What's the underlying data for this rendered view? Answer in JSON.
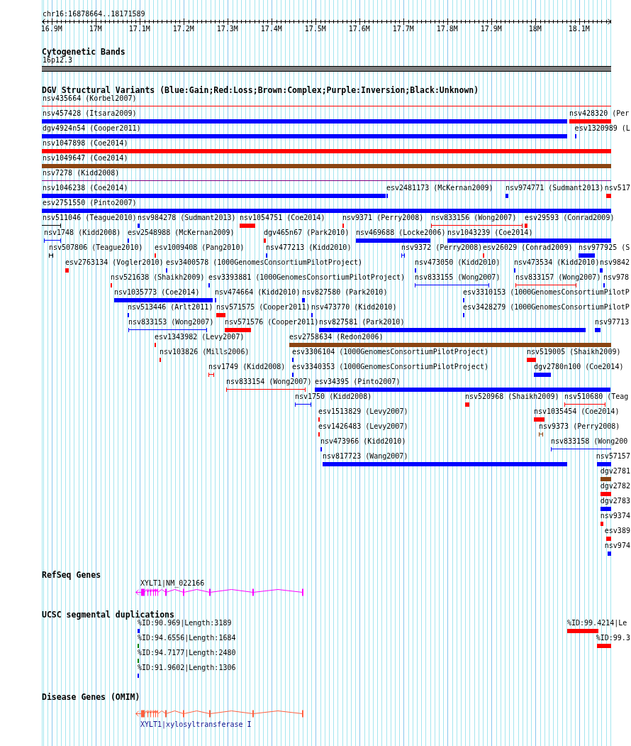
{
  "ruler": {
    "location": "chr16:16878664..18171589",
    "ticks": [
      "16.9M",
      "17M",
      "17.1M",
      "17.2M",
      "17.3M",
      "17.4M",
      "17.5M",
      "17.6M",
      "17.7M",
      "17.8M",
      "17.9M",
      "18M",
      "18.1M"
    ]
  },
  "tracks": [
    {
      "kind": "cytoband",
      "title": "Cytogenetic Bands",
      "band": {
        "label": "16p12.3"
      }
    },
    {
      "kind": "features",
      "title": "DGV Structural Variants (Blue:Gain;Red:Loss;Brown:Complex;Purple:Inversion;Black:Unknown)",
      "lanes": [
        {
          "features": [
            {
              "label": "nsv435664 (Korbel2007)",
              "kind": "span",
              "color": "#ff0000"
            }
          ]
        },
        {
          "features": [
            {
              "label": "nsv457428 (Itsara2009)",
              "kind": "bar",
              "color": "#0000ff"
            },
            {
              "label": "nsv428320 (Per",
              "kind": "bar",
              "color": "#ff0000"
            }
          ]
        },
        {
          "features": [
            {
              "label": "dgv4924n54 (Cooper2011)",
              "kind": "bar",
              "color": "#0000ff"
            },
            {
              "label": "esv1320989 (L",
              "kind": "bar",
              "color": "#0000ff"
            }
          ]
        },
        {
          "features": [
            {
              "label": "nsv1047898 (Coe2014)",
              "kind": "bar",
              "color": "#ff0000"
            }
          ]
        },
        {
          "features": [
            {
              "label": "nsv1049647 (Coe2014)",
              "kind": "bar",
              "color": "#8b4513"
            }
          ]
        },
        {
          "features": [
            {
              "label": "nsv7278 (Kidd2008)",
              "kind": "span",
              "color": "#800080"
            }
          ]
        },
        {
          "features": [
            {
              "label": "nsv1046238 (Coe2014)",
              "kind": "bar",
              "color": "#0000ff"
            },
            {
              "label": "esv2481173 (McKernan2009)",
              "kind": "bar",
              "color": "#0000ff"
            },
            {
              "label": "nsv974771 (Sudmant2013)",
              "kind": "bar",
              "color": "#0000ff"
            },
            {
              "label": "nsv517",
              "kind": "bar",
              "color": "#ff0000"
            }
          ]
        },
        {
          "features": [
            {
              "label": "esv2751550 (Pinto2007)",
              "kind": "bar",
              "color": "#0000ff"
            }
          ]
        },
        {
          "features": [
            {
              "label": "nsv511046 (Teague2010)",
              "kind": "span",
              "color": "#000000"
            },
            {
              "label": "nsv984278 (Sudmant2013)",
              "kind": "bar",
              "color": "#0000ff"
            },
            {
              "label": "nsv1054751 (Coe2014)",
              "kind": "bar",
              "color": "#ff0000"
            },
            {
              "label": "nsv9371 (Perry2008)",
              "kind": "bar",
              "color": "#ff0000"
            },
            {
              "label": "nsv833156 (Wong2007)",
              "kind": "span",
              "color": "#ff0000"
            },
            {
              "label": "esv29593 (Conrad2009)",
              "kind": "bar",
              "color": "#ff0000"
            }
          ]
        },
        {
          "features": [
            {
              "label": "nsv1748 (Kidd2008)",
              "kind": "span",
              "color": "#0000ff"
            },
            {
              "label": "esv2548988 (McKernan2009)",
              "kind": "bar",
              "color": "#0000ff"
            },
            {
              "label": "dgv465n67 (Park2010)",
              "kind": "bar",
              "color": "#ff0000"
            },
            {
              "label": "nsv469688 (Locke2006)",
              "kind": "bar",
              "color": "#0000ff"
            },
            {
              "label": "nsv1043239 (Coe2014)",
              "kind": "bar",
              "color": "#0000ff"
            }
          ]
        },
        {
          "features": [
            {
              "label": "nsv507806 (Teague2010)",
              "kind": "span",
              "color": "#000000"
            },
            {
              "label": "esv1009408 (Pang2010)",
              "kind": "bar",
              "color": "#ff0000"
            },
            {
              "label": "nsv477213 (Kidd2010)",
              "kind": "bar",
              "color": "#0000ff"
            },
            {
              "label": "nsv9372 (Perry2008)",
              "kind": "span",
              "color": "#0000ff"
            },
            {
              "label": "esv26029 (Conrad2009)",
              "kind": "bar",
              "color": "#ff0000"
            },
            {
              "label": "nsv977925 (S",
              "kind": "bar",
              "color": "#0000ff"
            }
          ]
        },
        {
          "features": [
            {
              "label": "esv2763134 (Vogler2010)",
              "kind": "bar",
              "color": "#ff0000"
            },
            {
              "label": "esv3400578 (1000GenomesConsortiumPilotProject)",
              "kind": "bar",
              "color": "#0000ff"
            },
            {
              "label": "nsv473050 (Kidd2010)",
              "kind": "bar",
              "color": "#0000ff"
            },
            {
              "label": "nsv473534 (Kidd2010)",
              "kind": "bar",
              "color": "#0000ff"
            },
            {
              "label": "nsv9842",
              "kind": "bar",
              "color": "#0000ff"
            }
          ]
        },
        {
          "features": [
            {
              "label": "nsv521638 (Shaikh2009)",
              "kind": "bar",
              "color": "#ff0000"
            },
            {
              "label": "esv3393881 (1000GenomesConsortiumPilotProject)",
              "kind": "bar",
              "color": "#0000ff"
            },
            {
              "label": "nsv833155 (Wong2007)",
              "kind": "span",
              "color": "#0000ff"
            },
            {
              "label": "nsv833157 (Wong2007)",
              "kind": "span",
              "color": "#ff0000"
            },
            {
              "label": "nsv978",
              "kind": "bar",
              "color": "#0000ff"
            }
          ]
        },
        {
          "features": [
            {
              "label": "nsv1035773 (Coe2014)",
              "kind": "bar",
              "color": "#0000ff"
            },
            {
              "label": "nsv474664 (Kidd2010)",
              "kind": "bar",
              "color": "#0000ff"
            },
            {
              "label": "nsv827580 (Park2010)",
              "kind": "bar",
              "color": "#0000ff"
            },
            {
              "label": "esv3310153 (1000GenomesConsortiumPilotP",
              "kind": "bar",
              "color": "#0000ff"
            }
          ]
        },
        {
          "features": [
            {
              "label": "nsv513446 (Arlt2011)",
              "kind": "bar",
              "color": "#0000ff"
            },
            {
              "label": "nsv571575 (Cooper2011)",
              "kind": "bar",
              "color": "#ff0000"
            },
            {
              "label": "nsv473770 (Kidd2010)",
              "kind": "bar",
              "color": "#0000ff"
            },
            {
              "label": "esv3428279 (1000GenomesConsortiumPilotP",
              "kind": "bar",
              "color": "#0000ff"
            }
          ]
        },
        {
          "features": [
            {
              "label": "nsv833153 (Wong2007)",
              "kind": "span",
              "color": "#0000ff"
            },
            {
              "label": "nsv571576 (Cooper2011)",
              "kind": "bar",
              "color": "#ff0000"
            },
            {
              "label": "nsv827581 (Park2010)",
              "kind": "bar",
              "color": "#0000ff"
            },
            {
              "label": "nsv97713",
              "kind": "bar",
              "color": "#0000ff"
            }
          ]
        },
        {
          "features": [
            {
              "label": "esv1343982 (Levy2007)",
              "kind": "bar",
              "color": "#ff0000"
            },
            {
              "label": "esv2758634 (Redon2006)",
              "kind": "bar",
              "color": "#8b4513"
            }
          ]
        },
        {
          "features": [
            {
              "label": "nsv103826 (Mills2006)",
              "kind": "bar",
              "color": "#ff0000"
            },
            {
              "label": "esv3306104 (1000GenomesConsortiumPilotProject)",
              "kind": "bar",
              "color": "#0000ff"
            },
            {
              "label": "nsv519005 (Shaikh2009)",
              "kind": "bar",
              "color": "#ff0000"
            }
          ]
        },
        {
          "features": [
            {
              "label": "nsv1749 (Kidd2008)",
              "kind": "span",
              "color": "#ff0000"
            },
            {
              "label": "esv3340353 (1000GenomesConsortiumPilotProject)",
              "kind": "bar",
              "color": "#0000ff"
            },
            {
              "label": "dgv2780n100 (Coe2014)",
              "kind": "bar",
              "color": "#0000ff"
            }
          ]
        },
        {
          "features": [
            {
              "label": "nsv833154 (Wong2007)",
              "kind": "span",
              "color": "#ff0000"
            },
            {
              "label": "esv34395 (Pinto2007)",
              "kind": "bar",
              "color": "#0000ff"
            }
          ]
        },
        {
          "features": [
            {
              "label": "nsv1750 (Kidd2008)",
              "kind": "span",
              "color": "#0000ff"
            },
            {
              "label": "nsv520968 (Shaikh2009)",
              "kind": "bar",
              "color": "#ff0000"
            },
            {
              "label": "nsv510680 (Teag",
              "kind": "span",
              "color": "#ff0000"
            }
          ]
        },
        {
          "features": [
            {
              "label": "esv1513829 (Levy2007)",
              "kind": "bar",
              "color": "#ff0000"
            },
            {
              "label": "nsv1035454 (Coe2014)",
              "kind": "bar",
              "color": "#ff0000"
            }
          ]
        },
        {
          "features": [
            {
              "label": "esv1426483 (Levy2007)",
              "kind": "bar",
              "color": "#ff0000"
            },
            {
              "label": "nsv9373 (Perry2008)",
              "kind": "span",
              "color": "#8b4513"
            }
          ]
        },
        {
          "features": [
            {
              "label": "nsv473966 (Kidd2010)",
              "kind": "bar",
              "color": "#0000ff"
            },
            {
              "label": "nsv833158 (Wong200",
              "kind": "span",
              "color": "#0000ff"
            }
          ]
        },
        {
          "features": [
            {
              "label": "nsv817723 (Wang2007)",
              "kind": "bar",
              "color": "#0000ff"
            },
            {
              "label": "nsv57157",
              "kind": "bar",
              "color": "#0000ff"
            }
          ]
        },
        {
          "features": [
            {
              "label": "dgv2781",
              "kind": "bar",
              "color": "#8b4513"
            }
          ]
        },
        {
          "features": [
            {
              "label": "dgv2782",
              "kind": "bar",
              "color": "#ff0000"
            }
          ]
        },
        {
          "features": [
            {
              "label": "dgv2783",
              "kind": "bar",
              "color": "#0000ff"
            }
          ]
        },
        {
          "features": [
            {
              "label": "nsv9374",
              "kind": "bar",
              "color": "#ff0000"
            }
          ]
        },
        {
          "features": [
            {
              "label": "esv389",
              "kind": "bar",
              "color": "#ff0000"
            }
          ]
        },
        {
          "features": [
            {
              "label": "nsv974",
              "kind": "bar",
              "color": "#0000ff"
            }
          ]
        }
      ]
    },
    {
      "kind": "gene",
      "title": "RefSeq Genes",
      "gene": {
        "label": "XYLT1|NM_022166"
      }
    },
    {
      "kind": "features",
      "title": "UCSC segmental duplications",
      "lanes": [
        {
          "features": [
            {
              "label": "%ID:90.969|Length:3189",
              "kind": "bar",
              "color": "#0000ff"
            },
            {
              "label": "%ID:99.4214|Le",
              "kind": "bar",
              "color": "#ff0000"
            }
          ]
        },
        {
          "features": [
            {
              "label": "%ID:94.6556|Length:1684",
              "kind": "bar",
              "color": "#008000"
            },
            {
              "label": "%ID:99.3",
              "kind": "bar",
              "color": "#ff0000"
            }
          ]
        },
        {
          "features": [
            {
              "label": "%ID:94.7177|Length:2480",
              "kind": "bar",
              "color": "#008000"
            }
          ]
        },
        {
          "features": [
            {
              "label": "%ID:91.9602|Length:1306",
              "kind": "bar",
              "color": "#0000ff"
            }
          ]
        }
      ]
    },
    {
      "kind": "disease-gene",
      "title": "Disease Genes (OMIM)",
      "gene": {
        "label": "XYLT1|xylosyltransferase I"
      }
    }
  ]
}
